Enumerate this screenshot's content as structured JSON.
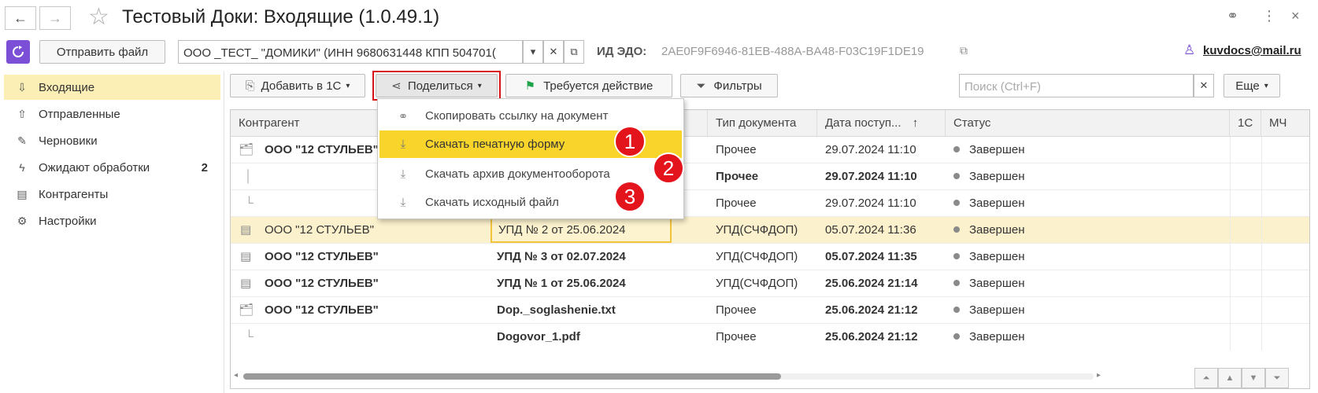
{
  "window": {
    "title": "Тестовый Доки: Входящие (1.0.49.1)",
    "back_icon": "←",
    "forward_icon": "→",
    "star_icon": "☆",
    "link_icon": "⚭",
    "more_icon": "⋮",
    "close_icon": "×"
  },
  "toolbar": {
    "send_file_label": "Отправить файл",
    "org_value": "ООО _ТЕСТ_ \"ДОМИКИ\" (ИНН 9680631448 КПП 504701(",
    "edo_label": "ИД ЭДО:",
    "edo_value": "2AE0F9F6946-81EB-488A-BA48-F03C19F1DE19",
    "user_email": "kuvdocs@mail.ru"
  },
  "sidebar": {
    "items": [
      {
        "label": "Входящие",
        "icon": "⇩",
        "count": ""
      },
      {
        "label": "Отправленные",
        "icon": "⇧",
        "count": ""
      },
      {
        "label": "Черновики",
        "icon": "✎",
        "count": ""
      },
      {
        "label": "Ожидают обработки",
        "icon": "ϟ",
        "count": "2"
      },
      {
        "label": "Контрагенты",
        "icon": "▤",
        "count": ""
      },
      {
        "label": "Настройки",
        "icon": "⚙",
        "count": ""
      }
    ]
  },
  "actions": {
    "add_1c": "Добавить в 1С",
    "share": "Поделиться",
    "action_required": "Требуется действие",
    "filters": "Фильтры",
    "search_placeholder": "Поиск (Ctrl+F)",
    "more": "Еще"
  },
  "share_menu": {
    "items": [
      {
        "label": "Скопировать ссылку на документ",
        "icon": "🔗"
      },
      {
        "label": "Скачать печатную форму",
        "icon": "⭳"
      },
      {
        "label": "Скачать архив документооборота",
        "icon": "⭳"
      },
      {
        "label": "Скачать исходный файл",
        "icon": "⭳"
      }
    ],
    "badges": [
      "1",
      "2",
      "3"
    ]
  },
  "table": {
    "columns": [
      "Контрагент",
      "Тип документа",
      "Дата поступ...",
      "Статус",
      "1С",
      "МЧ"
    ],
    "sort_icon": "↑",
    "rows": [
      {
        "contractor": "ООО \"12 СТУЛЬЕВ\"",
        "doc": "",
        "type": "Прочее",
        "date": "29.07.2024 11:10",
        "status": "Завершен"
      },
      {
        "contractor": "",
        "doc": "",
        "type": "Прочее",
        "date": "29.07.2024 11:10",
        "status": "Завершен"
      },
      {
        "contractor": "",
        "doc": "",
        "type": "Прочее",
        "date": "29.07.2024 11:10",
        "status": "Завершен"
      },
      {
        "contractor": "ООО \"12 СТУЛЬЕВ\"",
        "doc": "УПД № 2 от 25.06.2024",
        "type": "УПД(СЧФДОП)",
        "date": "05.07.2024 11:36",
        "status": "Завершен"
      },
      {
        "contractor": "ООО \"12 СТУЛЬЕВ\"",
        "doc": "УПД № 3 от 02.07.2024",
        "type": "УПД(СЧФДОП)",
        "date": "05.07.2024 11:35",
        "status": "Завершен"
      },
      {
        "contractor": "ООО \"12 СТУЛЬЕВ\"",
        "doc": "УПД № 1 от 25.06.2024",
        "type": "УПД(СЧФДОП)",
        "date": "25.06.2024 21:14",
        "status": "Завершен"
      },
      {
        "contractor": "ООО \"12 СТУЛЬЕВ\"",
        "doc": "Dop._soglashenie.txt",
        "type": "Прочее",
        "date": "25.06.2024 21:12",
        "status": "Завершен"
      },
      {
        "contractor": "",
        "doc": "Dogovor_1.pdf",
        "type": "Прочее",
        "date": "25.06.2024 21:12",
        "status": "Завершен"
      }
    ]
  },
  "colors": {
    "accent": "#7b4fd6",
    "highlight": "#f9d42b",
    "selected_row": "#fbf1cc",
    "badge": "#e3141b"
  }
}
